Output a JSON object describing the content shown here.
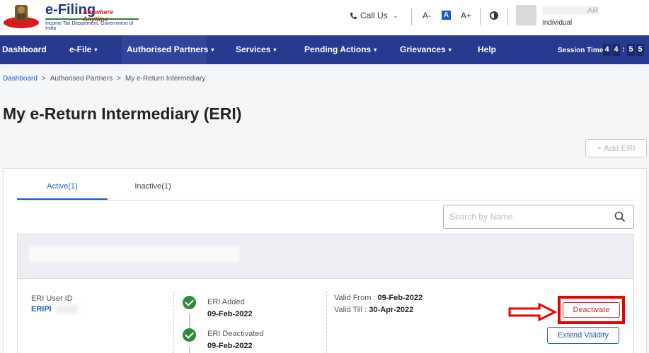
{
  "header": {
    "logo_title": "e-Filing",
    "logo_tagline": "Anywhere Anytime",
    "logo_subtitle": "Income Tax Department, Government of India",
    "call_us": "Call Us",
    "font_decrease": "A-",
    "font_normal": "A",
    "font_increase": "A+",
    "user_name_suffix": "AR",
    "user_type": "Individual"
  },
  "nav": {
    "items": [
      {
        "label": "Dashboard"
      },
      {
        "label": "e-File"
      },
      {
        "label": "Authorised Partners"
      },
      {
        "label": "Services"
      },
      {
        "label": "Pending Actions"
      },
      {
        "label": "Grievances"
      },
      {
        "label": "Help"
      }
    ],
    "session_label": "Session Time",
    "session_digits": [
      "4",
      "4",
      ":",
      "5",
      "5"
    ]
  },
  "breadcrumb": {
    "items": [
      "Dashboard",
      "Authorised Partners",
      "My e-Return Intermediary"
    ],
    "separator": ">"
  },
  "page": {
    "title": "My e-Return Intermediary (ERI)",
    "add_button": "+ Add ERI"
  },
  "tabs": {
    "active": "Active(1)",
    "inactive": "Inactive(1)"
  },
  "search": {
    "placeholder": "Search by Name"
  },
  "card": {
    "eri_user_id_label": "ERI User ID",
    "eri_user_id_value": "ERIPI",
    "status_added_label": "ERI Added",
    "status_added_date": "09-Feb-2022",
    "status_deactivated_label": "ERI Deactivated",
    "status_deactivated_date": "09-Feb-2022",
    "valid_from_label": "Valid From : ",
    "valid_from_value": "09-Feb-2022",
    "valid_till_label": "Valid Till : ",
    "valid_till_value": "30-Apr-2022",
    "deactivate_button": "Deactivate",
    "extend_button": "Extend Validity"
  },
  "colors": {
    "nav_bg": "#263a8f",
    "accent": "#1e5bbf",
    "danger": "#d32f2f",
    "success": "#2e8b3a"
  }
}
